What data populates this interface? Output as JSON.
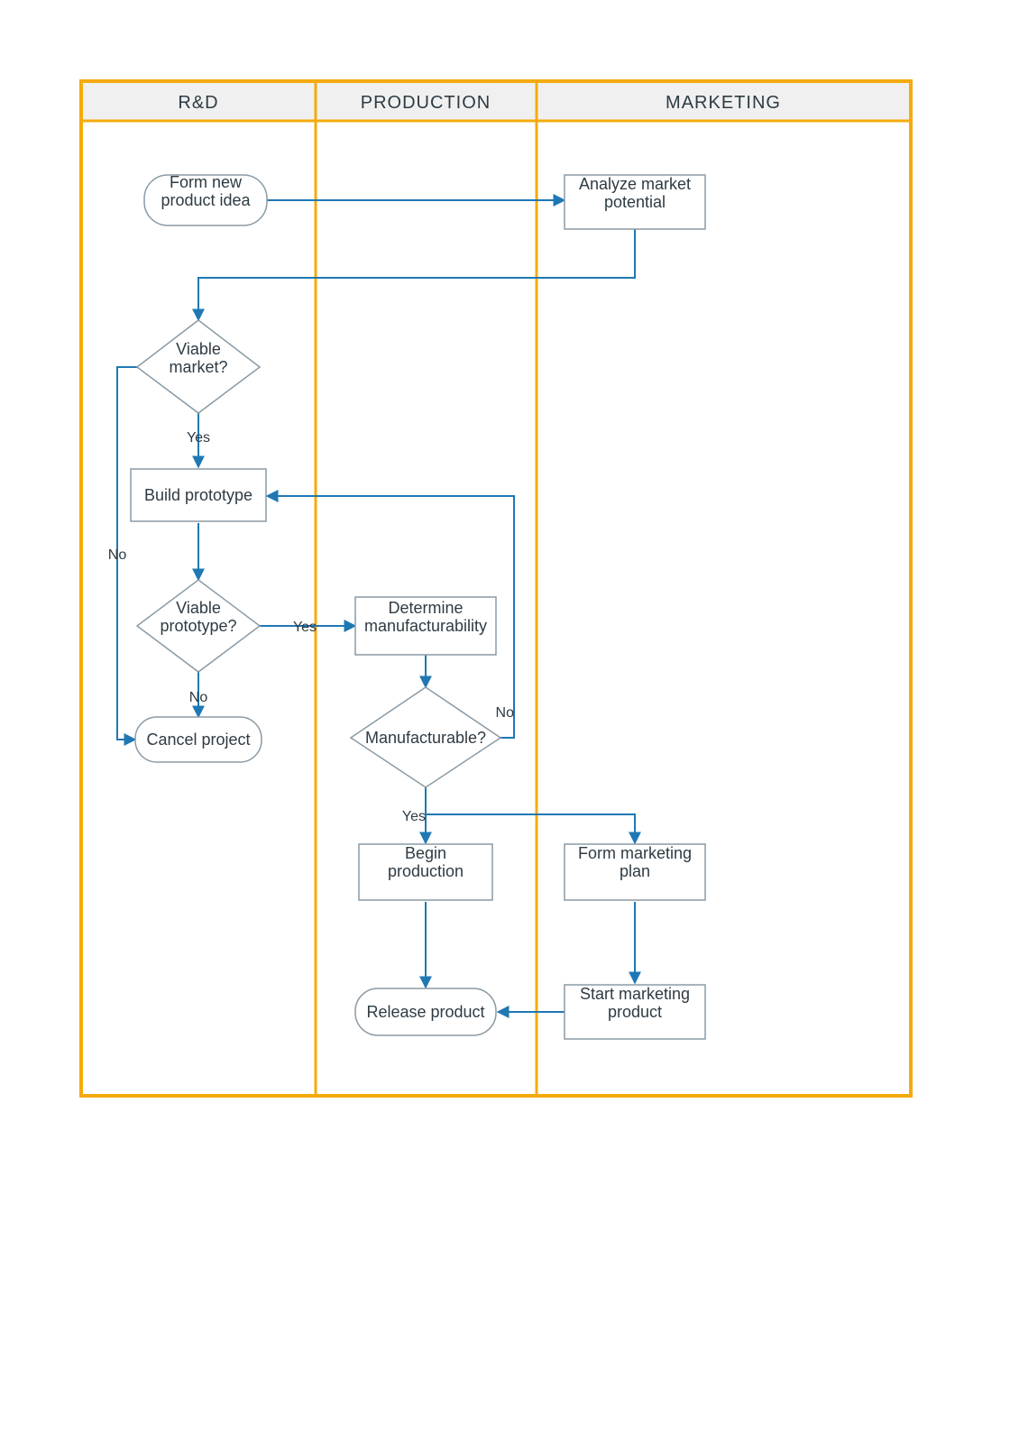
{
  "colors": {
    "swimlane_border": "#f5ab0c",
    "header_fill": "#f0f0f0",
    "node_stroke": "#8a9aa5",
    "connector": "#1f78b4",
    "text": "#2e3b44"
  },
  "lanes": {
    "rd": "R&D",
    "production": "PRODUCTION",
    "marketing": "MARKETING"
  },
  "nodes": {
    "form_idea": "Form new\nproduct idea",
    "analyze_market": "Analyze market\npotential",
    "viable_market": "Viable\nmarket?",
    "build_prototype": "Build prototype",
    "viable_prototype": "Viable\nprototype?",
    "cancel_project": "Cancel project",
    "determine_mfg": "Determine\nmanufacturability",
    "manufacturable": "Manufacturable?",
    "begin_production": "Begin\nproduction",
    "release_product": "Release product",
    "form_marketing": "Form marketing\nplan",
    "start_marketing": "Start marketing\nproduct"
  },
  "edge_labels": {
    "yes": "Yes",
    "no": "No"
  }
}
